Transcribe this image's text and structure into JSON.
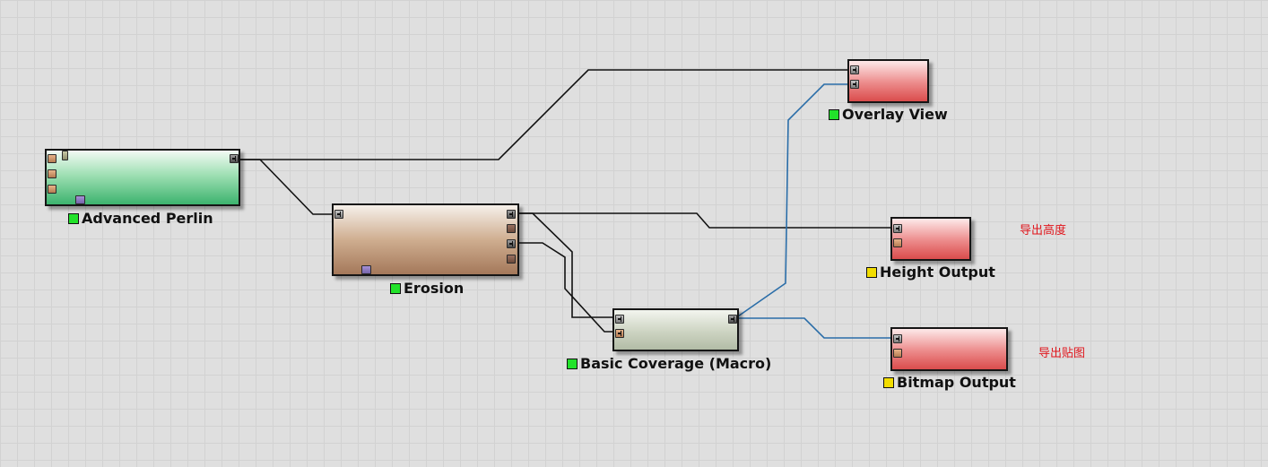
{
  "colors": {
    "status_ok": "#22e22a",
    "status_warn": "#f2dd00",
    "wire_black": "#111111",
    "wire_blue": "#2a6da8",
    "note_red": "#e0161c"
  },
  "nodes": [
    {
      "id": "perlin",
      "name": "Advanced Perlin",
      "status": "ok"
    },
    {
      "id": "erosion",
      "name": "Erosion",
      "status": "ok"
    },
    {
      "id": "coverage",
      "name": "Basic Coverage (Macro)",
      "status": "ok"
    },
    {
      "id": "overlay",
      "name": "Overlay View",
      "status": "ok"
    },
    {
      "id": "height",
      "name": "Height Output",
      "status": "warn"
    },
    {
      "id": "bitmap",
      "name": "Bitmap Output",
      "status": "warn"
    }
  ],
  "notes": {
    "height": "导出高度",
    "bitmap": "导出贴图"
  }
}
